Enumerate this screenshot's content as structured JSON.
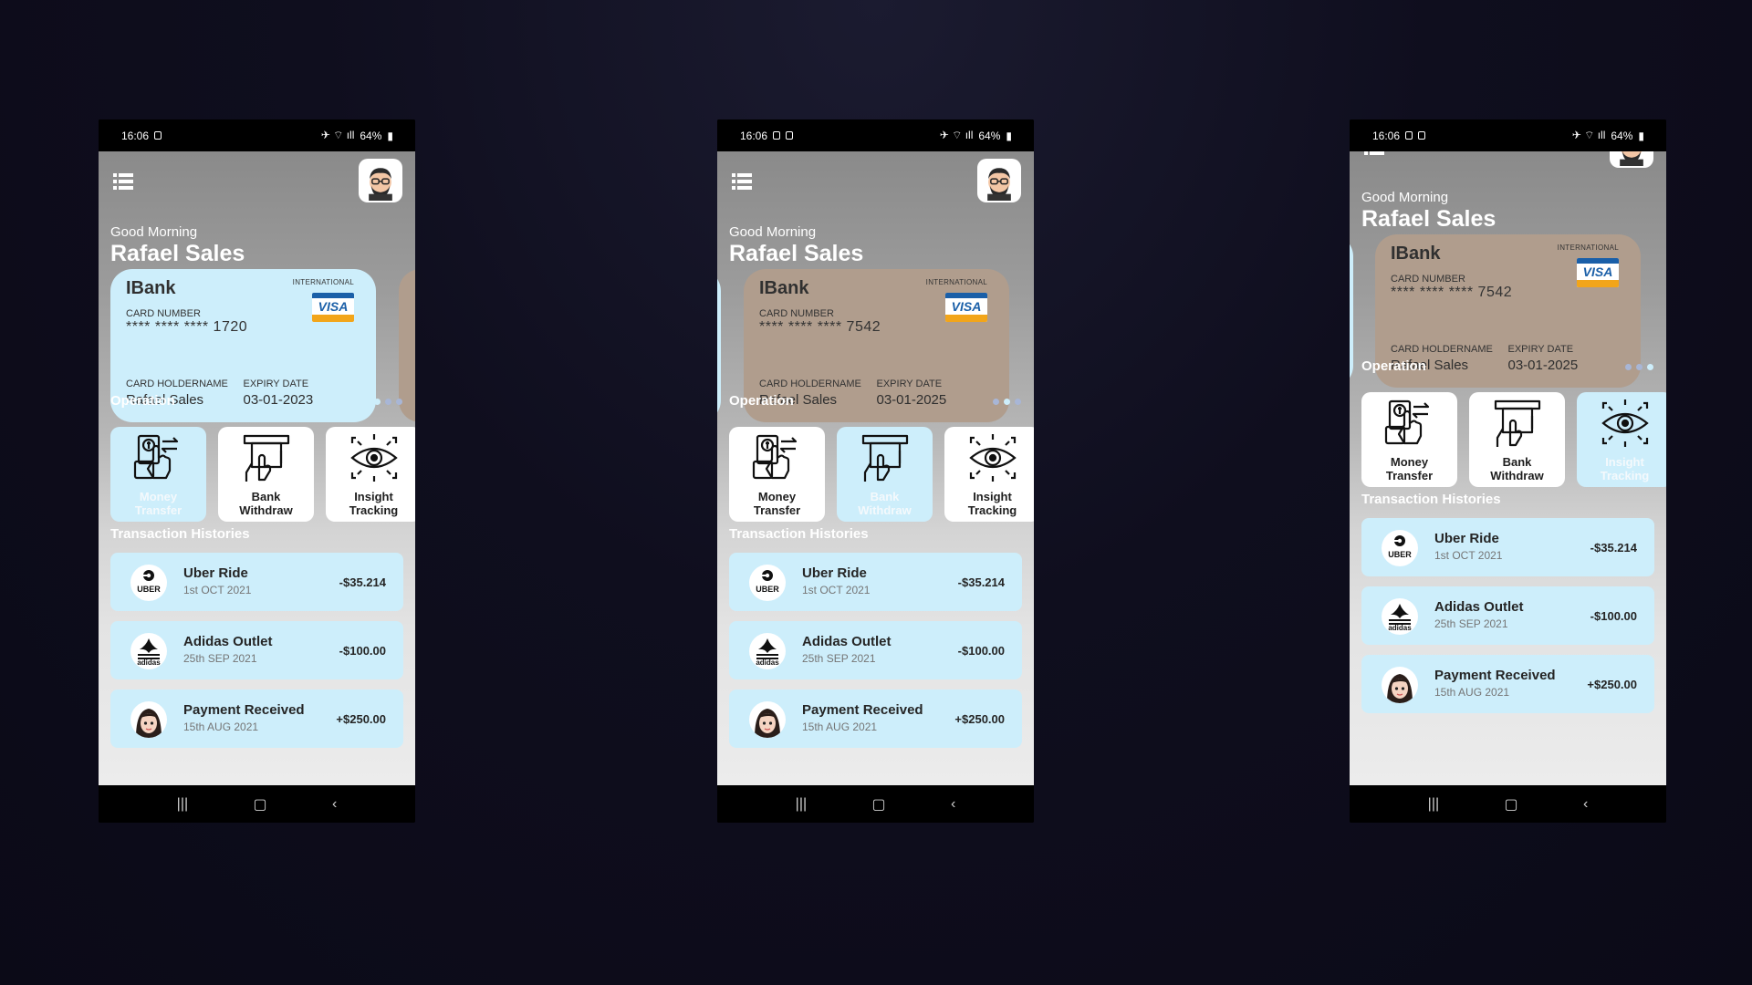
{
  "status_bar": {
    "time": "16:06",
    "battery": "64%"
  },
  "greeting": "Good Morning",
  "user_name": "Rafael Sales",
  "card_static": {
    "bank": "IBank",
    "network": "VISA",
    "international": "INTERNATIONAL",
    "number_label": "CARD NUMBER",
    "holder_label": "CARD HOLDERNAME",
    "expiry_label": "EXPIRY DATE"
  },
  "cards": [
    {
      "number": "**** **** **** 1720",
      "holder": "Rafael Sales",
      "expiry": "03-01-2023",
      "color": "#cdeefb"
    },
    {
      "number": "**** **** **** 7542",
      "holder": "Rafael Sales",
      "expiry": "03-01-2025",
      "color": "#b09d8d"
    }
  ],
  "sections": {
    "operation": "Operation",
    "transactions": "Transaction Histories"
  },
  "operations": [
    {
      "line1": "Money",
      "line2": "Transfer",
      "icon": "money-transfer-icon"
    },
    {
      "line1": "Bank",
      "line2": "Withdraw",
      "icon": "bank-withdraw-icon"
    },
    {
      "line1": "Insight",
      "line2": "Tracking",
      "icon": "insight-tracking-icon"
    }
  ],
  "transactions": [
    {
      "title": "Uber Ride",
      "date": "1st OCT 2021",
      "amount": "-$35.214",
      "logo": "UBER"
    },
    {
      "title": "Adidas Outlet",
      "date": "25th SEP 2021",
      "amount": "-$100.00",
      "logo": "adidas"
    },
    {
      "title": "Payment Received",
      "date": "15th AUG 2021",
      "amount": "+$250.00",
      "logo": "person-avatar"
    }
  ],
  "screens": [
    {
      "active_card": 0,
      "active_operation": 0,
      "active_dot": 0
    },
    {
      "active_card": 1,
      "active_operation": 1,
      "active_dot": 1
    },
    {
      "active_card": 1,
      "active_operation": 2,
      "active_dot": 2
    }
  ]
}
